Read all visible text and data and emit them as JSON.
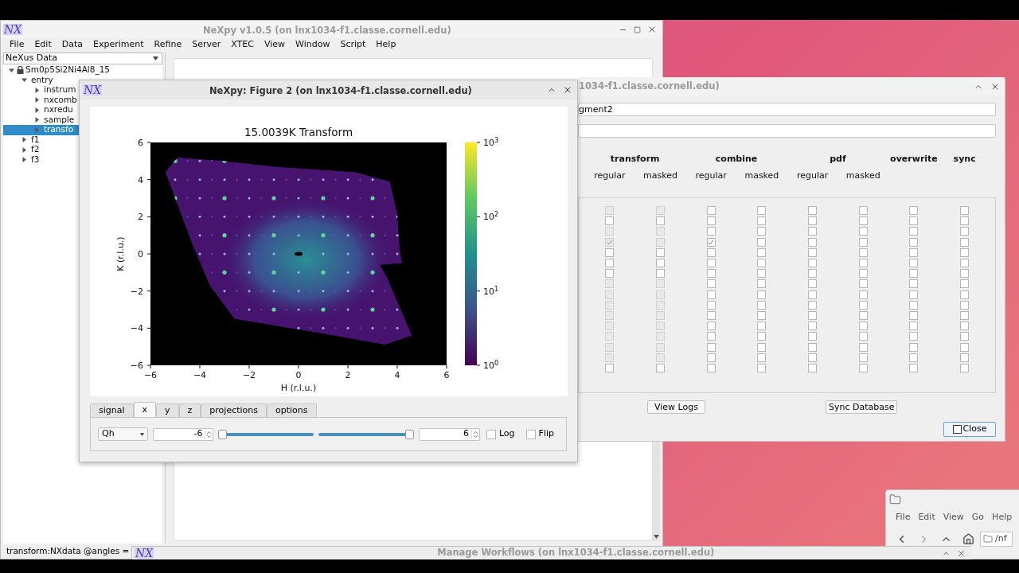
{
  "main_window": {
    "logo": "NX",
    "title": "NeXpy v1.0.5 (on lnx1034-f1.classe.cornell.edu)",
    "menu": [
      "File",
      "Edit",
      "Data",
      "Experiment",
      "Refine",
      "Server",
      "XTEC",
      "View",
      "Window",
      "Script",
      "Help"
    ],
    "tree_header": "NeXus Data",
    "tree": [
      {
        "label": "Sm0p5Si2Ni4Al8_15",
        "locked": true,
        "expanded": true,
        "selected": false,
        "children": [
          {
            "label": "entry",
            "expanded": true,
            "selected": false,
            "children": [
              {
                "label": "instrum",
                "expanded": false,
                "selected": false
              },
              {
                "label": "nxcomb",
                "expanded": false,
                "selected": false
              },
              {
                "label": "nxredu",
                "expanded": false,
                "selected": false
              },
              {
                "label": "sample",
                "expanded": false,
                "selected": false
              },
              {
                "label": "transfo",
                "expanded": false,
                "selected": true
              }
            ]
          },
          {
            "label": "f1",
            "expanded": false,
            "selected": false
          },
          {
            "label": "f2",
            "expanded": false,
            "selected": false
          },
          {
            "label": "f3",
            "expanded": false,
            "selected": false
          }
        ]
      }
    ],
    "status": "transform:NXdata @angles ="
  },
  "figure_window": {
    "logo": "NX",
    "title": "NeXpy: Figure 2 (on lnx1034-f1.classe.cornell.edu)",
    "plot": {
      "title": "15.0039K Transform",
      "xlabel": "H (r.l.u.)",
      "ylabel": "K (r.l.u.)",
      "xticks": [
        "−6",
        "−4",
        "−2",
        "0",
        "2",
        "4",
        "6"
      ],
      "yticks": [
        "6",
        "4",
        "2",
        "0",
        "−2",
        "−4",
        "−6"
      ],
      "colorbar_ticks": [
        "10$^{3}$",
        "10$^{2}$",
        "10$^{1}$",
        "10$^{0}$"
      ]
    },
    "tabs": [
      {
        "label": "signal",
        "selected": false
      },
      {
        "label": "x",
        "selected": true
      },
      {
        "label": "y",
        "selected": false
      },
      {
        "label": "z",
        "selected": false
      },
      {
        "label": "projections",
        "selected": false
      },
      {
        "label": "options",
        "selected": false
      }
    ],
    "axis_select": "Qh",
    "min_value": "-6",
    "max_value": "6",
    "sliders": [
      {
        "level": 0
      },
      {
        "level": 1
      }
    ],
    "options": [
      {
        "label": "Log",
        "checked": false
      },
      {
        "label": "Flip",
        "checked": false
      }
    ]
  },
  "workflow_window": {
    "title": "1034-f1.classe.cornell.edu)",
    "field_value": "gment2",
    "groups": [
      {
        "label": "transform",
        "sub": [
          "regular",
          "masked"
        ]
      },
      {
        "label": "combine",
        "sub": [
          "regular",
          "masked"
        ]
      },
      {
        "label": "pdf",
        "sub": [
          "regular",
          "masked"
        ]
      },
      {
        "label": "overwrite"
      },
      {
        "label": "sync"
      }
    ],
    "rows": [
      {
        "cells": [
          {
            "checked": false,
            "disabled": true
          },
          {
            "checked": false,
            "disabled": true
          },
          {
            "checked": false,
            "disabled": false
          },
          {
            "checked": false,
            "disabled": false
          },
          {
            "checked": false,
            "disabled": false
          },
          {
            "checked": false,
            "disabled": false
          },
          {
            "checked": false,
            "disabled": false
          },
          {
            "checked": false,
            "disabled": false
          }
        ]
      },
      {
        "cells": [
          {
            "checked": false,
            "disabled": false
          },
          {
            "checked": false,
            "disabled": false
          },
          {
            "checked": false,
            "disabled": false
          },
          {
            "checked": false,
            "disabled": false
          },
          {
            "checked": false,
            "disabled": false
          },
          {
            "checked": false,
            "disabled": false
          },
          {
            "checked": false,
            "disabled": false
          },
          {
            "checked": false,
            "disabled": false
          }
        ]
      },
      {
        "cells": [
          {
            "checked": false,
            "disabled": true
          },
          {
            "checked": false,
            "disabled": true
          },
          {
            "checked": false,
            "disabled": false
          },
          {
            "checked": false,
            "disabled": false
          },
          {
            "checked": false,
            "disabled": false
          },
          {
            "checked": false,
            "disabled": false
          },
          {
            "checked": false,
            "disabled": false
          },
          {
            "checked": false,
            "disabled": false
          }
        ]
      },
      {
        "cells": [
          {
            "checked": true,
            "disabled": true
          },
          {
            "checked": false,
            "disabled": true
          },
          {
            "checked": true,
            "disabled": false
          },
          {
            "checked": false,
            "disabled": false
          },
          {
            "checked": false,
            "disabled": false
          },
          {
            "checked": false,
            "disabled": false
          },
          {
            "checked": false,
            "disabled": false
          },
          {
            "checked": false,
            "disabled": false
          }
        ]
      },
      {
        "cells": [
          {
            "checked": false,
            "disabled": false
          },
          {
            "checked": false,
            "disabled": false
          },
          {
            "checked": false,
            "disabled": false
          },
          {
            "checked": false,
            "disabled": false
          },
          {
            "checked": false,
            "disabled": false
          },
          {
            "checked": false,
            "disabled": false
          },
          {
            "checked": false,
            "disabled": false
          },
          {
            "checked": false,
            "disabled": false
          }
        ]
      },
      {
        "cells": [
          {
            "checked": false,
            "disabled": false
          },
          {
            "checked": false,
            "disabled": false
          },
          {
            "checked": false,
            "disabled": false
          },
          {
            "checked": false,
            "disabled": false
          },
          {
            "checked": false,
            "disabled": false
          },
          {
            "checked": false,
            "disabled": false
          },
          {
            "checked": false,
            "disabled": false
          },
          {
            "checked": false,
            "disabled": false
          }
        ]
      },
      {
        "cells": [
          {
            "checked": false,
            "disabled": false
          },
          {
            "checked": false,
            "disabled": false
          },
          {
            "checked": false,
            "disabled": false
          },
          {
            "checked": false,
            "disabled": false
          },
          {
            "checked": false,
            "disabled": false
          },
          {
            "checked": false,
            "disabled": false
          },
          {
            "checked": false,
            "disabled": false
          },
          {
            "checked": false,
            "disabled": false
          }
        ]
      },
      {
        "cells": [
          {
            "checked": false,
            "disabled": true
          },
          {
            "checked": false,
            "disabled": true
          },
          {
            "checked": false,
            "disabled": false
          },
          {
            "checked": false,
            "disabled": false
          },
          {
            "checked": false,
            "disabled": false
          },
          {
            "checked": false,
            "disabled": false
          },
          {
            "checked": false,
            "disabled": false
          },
          {
            "checked": false,
            "disabled": false
          }
        ]
      },
      {
        "cells": [
          {
            "checked": false,
            "disabled": true
          },
          {
            "checked": false,
            "disabled": true
          },
          {
            "checked": false,
            "disabled": false
          },
          {
            "checked": false,
            "disabled": false
          },
          {
            "checked": false,
            "disabled": false
          },
          {
            "checked": false,
            "disabled": false
          },
          {
            "checked": false,
            "disabled": false
          },
          {
            "checked": false,
            "disabled": false
          }
        ]
      },
      {
        "cells": [
          {
            "checked": false,
            "disabled": true
          },
          {
            "checked": false,
            "disabled": true
          },
          {
            "checked": false,
            "disabled": false
          },
          {
            "checked": false,
            "disabled": false
          },
          {
            "checked": false,
            "disabled": false
          },
          {
            "checked": false,
            "disabled": false
          },
          {
            "checked": false,
            "disabled": false
          },
          {
            "checked": false,
            "disabled": false
          }
        ]
      },
      {
        "cells": [
          {
            "checked": false,
            "disabled": true
          },
          {
            "checked": false,
            "disabled": true
          },
          {
            "checked": false,
            "disabled": false
          },
          {
            "checked": false,
            "disabled": false
          },
          {
            "checked": false,
            "disabled": false
          },
          {
            "checked": false,
            "disabled": false
          },
          {
            "checked": false,
            "disabled": false
          },
          {
            "checked": false,
            "disabled": false
          }
        ]
      },
      {
        "cells": [
          {
            "checked": false,
            "disabled": true
          },
          {
            "checked": false,
            "disabled": true
          },
          {
            "checked": false,
            "disabled": false
          },
          {
            "checked": false,
            "disabled": false
          },
          {
            "checked": false,
            "disabled": false
          },
          {
            "checked": false,
            "disabled": false
          },
          {
            "checked": false,
            "disabled": false
          },
          {
            "checked": false,
            "disabled": false
          }
        ]
      },
      {
        "cells": [
          {
            "checked": false,
            "disabled": true
          },
          {
            "checked": false,
            "disabled": true
          },
          {
            "checked": false,
            "disabled": false
          },
          {
            "checked": false,
            "disabled": false
          },
          {
            "checked": false,
            "disabled": false
          },
          {
            "checked": false,
            "disabled": false
          },
          {
            "checked": false,
            "disabled": false
          },
          {
            "checked": false,
            "disabled": false
          }
        ]
      },
      {
        "cells": [
          {
            "checked": false,
            "disabled": true
          },
          {
            "checked": false,
            "disabled": true
          },
          {
            "checked": false,
            "disabled": false
          },
          {
            "checked": false,
            "disabled": false
          },
          {
            "checked": false,
            "disabled": false
          },
          {
            "checked": false,
            "disabled": false
          },
          {
            "checked": false,
            "disabled": false
          },
          {
            "checked": false,
            "disabled": false
          }
        ]
      },
      {
        "cells": [
          {
            "checked": false,
            "disabled": true
          },
          {
            "checked": false,
            "disabled": true
          },
          {
            "checked": false,
            "disabled": false
          },
          {
            "checked": false,
            "disabled": false
          },
          {
            "checked": false,
            "disabled": false
          },
          {
            "checked": false,
            "disabled": false
          },
          {
            "checked": false,
            "disabled": false
          },
          {
            "checked": false,
            "disabled": false
          }
        ]
      },
      {
        "cells": [
          {
            "checked": false,
            "disabled": false
          },
          {
            "checked": false,
            "disabled": false
          },
          {
            "checked": false,
            "disabled": false
          },
          {
            "checked": false,
            "disabled": false
          },
          {
            "checked": false,
            "disabled": false
          },
          {
            "checked": false,
            "disabled": false
          },
          {
            "checked": false,
            "disabled": false
          },
          {
            "checked": false,
            "disabled": false
          }
        ]
      }
    ],
    "buttons": [
      "View Logs",
      "Sync Database"
    ],
    "close_button": "Close"
  },
  "taskbar_window": {
    "logo": "NX",
    "title": "Manage Workflows (on lnx1034-f1.classe.cornell.edu)"
  },
  "file_manager": {
    "menu": [
      "File",
      "Edit",
      "View",
      "Go",
      "Help"
    ],
    "path": "/nf"
  }
}
